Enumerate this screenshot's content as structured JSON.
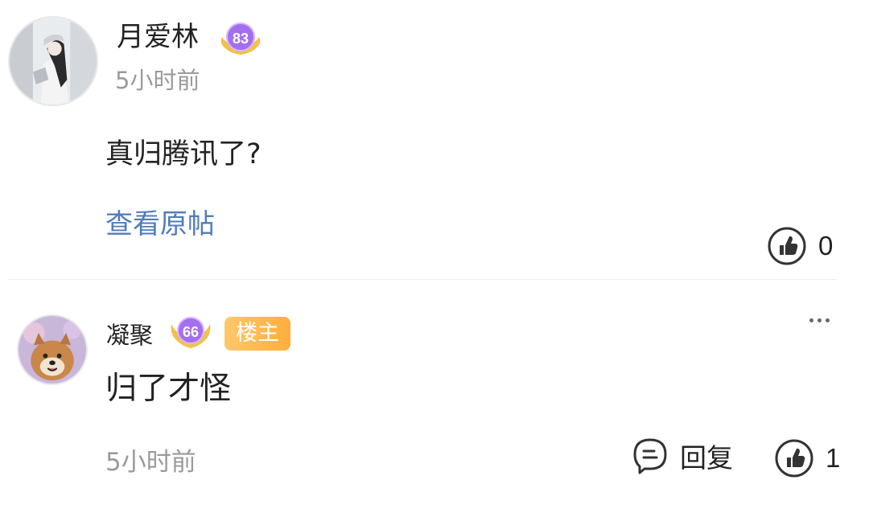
{
  "post": {
    "username": "月爱林",
    "level": "83",
    "time": "5小时前",
    "content": "真归腾讯了?",
    "view_original": "查看原帖",
    "like_count": "0"
  },
  "reply": {
    "username": "凝聚",
    "level": "66",
    "op_tag": "楼主",
    "content": "归了才怪",
    "time": "5小时前",
    "reply_label": "回复",
    "like_count": "1"
  },
  "icons": {
    "like": "thumbs-up-icon",
    "comment": "comment-bubble-icon",
    "more": "more-dots-icon",
    "level_badge": "level-badge-icon"
  },
  "colors": {
    "link": "#4f7cb8",
    "muted": "#9a9a9a",
    "op_tag": "#ffb84a",
    "badge": "#a46ef0"
  }
}
